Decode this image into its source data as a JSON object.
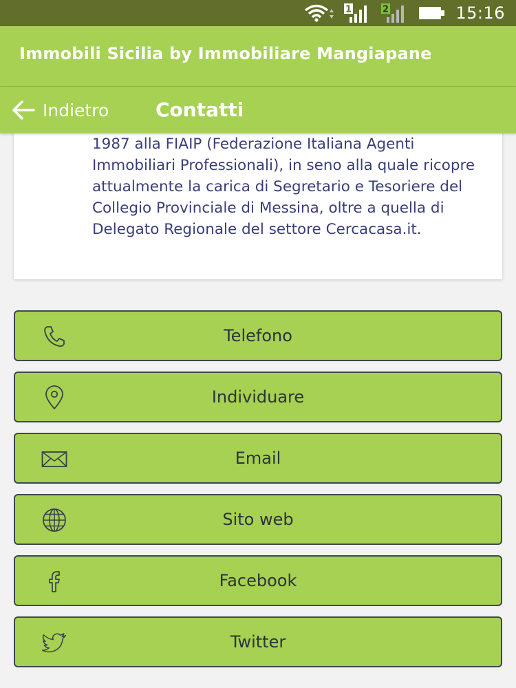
{
  "status_bar": {
    "time": "15:16",
    "sim1_label": "1",
    "sim2_label": "2"
  },
  "header": {
    "app_title": "Immobili Sicilia by Immobiliare Mangiapane"
  },
  "nav": {
    "back_label": "Indietro",
    "page_title": "Contatti"
  },
  "info_card": {
    "text": "1987 alla FIAIP (Federazione Italiana Agenti Immobiliari Professionali), in seno alla quale ricopre attualmente la carica di Segretario e Tesoriere del Collegio Provinciale di Messina, oltre a quella di Delegato Regionale del settore Cercacasa.it."
  },
  "contacts": [
    {
      "label": "Telefono",
      "icon": "phone-icon"
    },
    {
      "label": "Individuare",
      "icon": "location-pin-icon"
    },
    {
      "label": "Email",
      "icon": "envelope-icon"
    },
    {
      "label": "Sito web",
      "icon": "globe-icon"
    },
    {
      "label": "Facebook",
      "icon": "facebook-icon"
    },
    {
      "label": "Twitter",
      "icon": "twitter-bird-icon"
    }
  ],
  "colors": {
    "status_bar": "#616f2a",
    "header_green": "#a6d153",
    "button_border": "#3f4750",
    "card_text": "#3a3f78"
  }
}
